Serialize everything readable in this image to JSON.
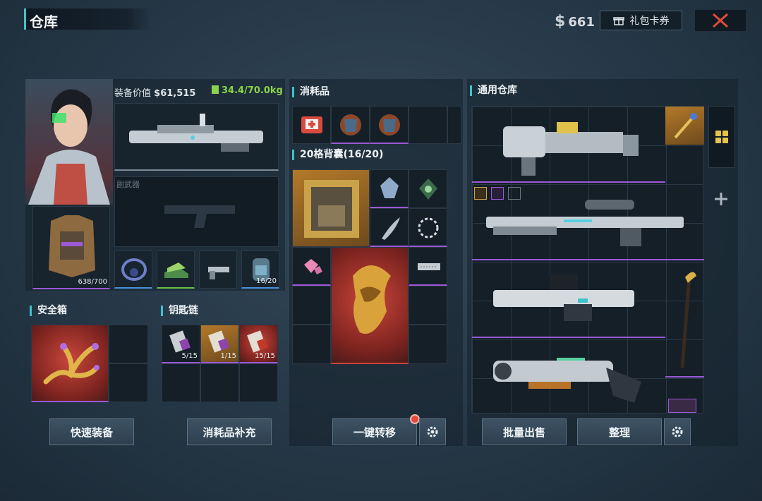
{
  "header": {
    "title": "仓库",
    "currency_symbol": "$",
    "currency_value": "661",
    "gift_label": "礼包卡券"
  },
  "equipment": {
    "value_label": "装备价值",
    "value_amount": "$61,515",
    "weight": "34.4/70.0kg",
    "secondary_weapon_label": "副武器",
    "armor_durability": "638/700",
    "backpack_durability": "16/20"
  },
  "consumables": {
    "title": "消耗品"
  },
  "backpack": {
    "title": "20格背囊(16/20)"
  },
  "general_storage": {
    "title": "通用仓库"
  },
  "safe_box": {
    "title": "安全箱"
  },
  "keychain": {
    "title": "钥匙链",
    "keys": [
      {
        "count": "5/15"
      },
      {
        "count": "1/15"
      },
      {
        "count": "15/15"
      }
    ]
  },
  "buttons": {
    "quick_equip": "快速装备",
    "refill_consumables": "消耗品补充",
    "one_click_transfer": "一键转移",
    "bulk_sell": "批量出售",
    "organize": "整理"
  },
  "colors": {
    "accent": "#3fc3c9",
    "purple": "#9b59d6",
    "gold": "#b3792a",
    "red": "#c9463b",
    "close": "#e24a3c"
  },
  "icons": [
    "dollar-icon",
    "gift-icon",
    "close-icon",
    "settings-gear-icon",
    "grid-view-icon",
    "plus-icon"
  ]
}
